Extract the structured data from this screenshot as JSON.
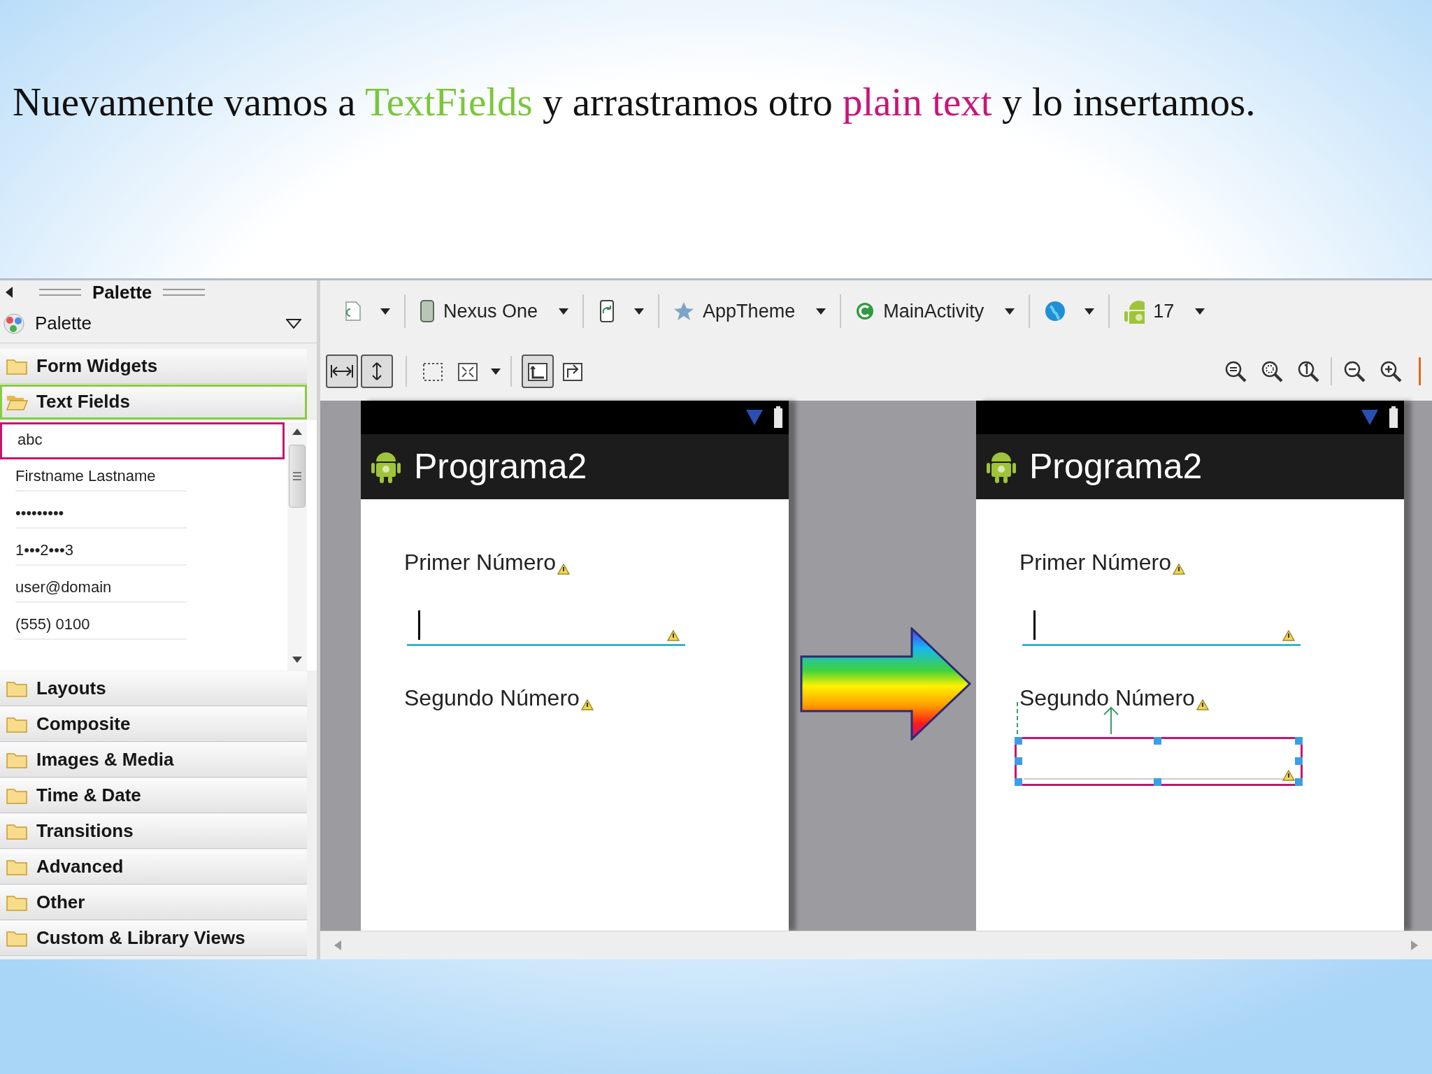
{
  "slide_title": [
    {
      "text": "Nuevamente vamos a",
      "color": "#111111"
    },
    {
      "text": "TextFields",
      "color": "#7cc63a"
    },
    {
      "text": "y arrastramos otro",
      "color": "#111111"
    },
    {
      "text": "plain text",
      "color": "#c8157a"
    },
    {
      "text": "y lo insertamos.",
      "color": "#111111"
    }
  ],
  "palette": {
    "header": "Palette",
    "selector": "Palette",
    "categories": [
      {
        "label": "Form Widgets",
        "expanded": false,
        "selected": false
      },
      {
        "label": "Text Fields",
        "expanded": true,
        "selected": true,
        "items": [
          {
            "label": "abc",
            "selected": true
          },
          {
            "label": "Firstname Lastname",
            "selected": false
          },
          {
            "label": "•••••••••",
            "selected": false
          },
          {
            "label": "1•••2•••3",
            "selected": false
          },
          {
            "label": "user@domain",
            "selected": false
          },
          {
            "label": "(555) 0100",
            "selected": false
          }
        ]
      },
      {
        "label": "Layouts",
        "expanded": false,
        "selected": false
      },
      {
        "label": "Composite",
        "expanded": false,
        "selected": false
      },
      {
        "label": "Images & Media",
        "expanded": false,
        "selected": false
      },
      {
        "label": "Time & Date",
        "expanded": false,
        "selected": false
      },
      {
        "label": "Transitions",
        "expanded": false,
        "selected": false
      },
      {
        "label": "Advanced",
        "expanded": false,
        "selected": false
      },
      {
        "label": "Other",
        "expanded": false,
        "selected": false
      },
      {
        "label": "Custom & Library Views",
        "expanded": false,
        "selected": false
      }
    ]
  },
  "toolbar": {
    "dropdowns": [
      {
        "kind": "file"
      },
      {
        "kind": "device",
        "label": "Nexus One"
      },
      {
        "kind": "orientation"
      },
      {
        "kind": "theme",
        "label": "AppTheme"
      },
      {
        "kind": "activity",
        "label": "MainActivity"
      },
      {
        "kind": "locale"
      },
      {
        "kind": "api",
        "label": "17"
      }
    ],
    "toggles": [
      {
        "kind": "width",
        "on": true
      },
      {
        "kind": "height",
        "on": true
      },
      {
        "kind": "margins",
        "on": false
      },
      {
        "kind": "resize",
        "on": false
      },
      {
        "kind": "clip",
        "on": true
      },
      {
        "kind": "layout",
        "on": false
      }
    ]
  },
  "previews": [
    {
      "title": "Programa2",
      "fields": [
        {
          "kind": "label",
          "text": "Primer Número"
        },
        {
          "kind": "input",
          "focused": true,
          "selected": false
        },
        {
          "kind": "label",
          "text": "Segundo Número"
        }
      ]
    },
    {
      "title": "Programa2",
      "fields": [
        {
          "kind": "label",
          "text": "Primer Número"
        },
        {
          "kind": "input",
          "focused": true,
          "selected": false
        },
        {
          "kind": "label",
          "text": "Segundo Número"
        },
        {
          "kind": "input",
          "focused": false,
          "selected": true
        }
      ]
    }
  ]
}
